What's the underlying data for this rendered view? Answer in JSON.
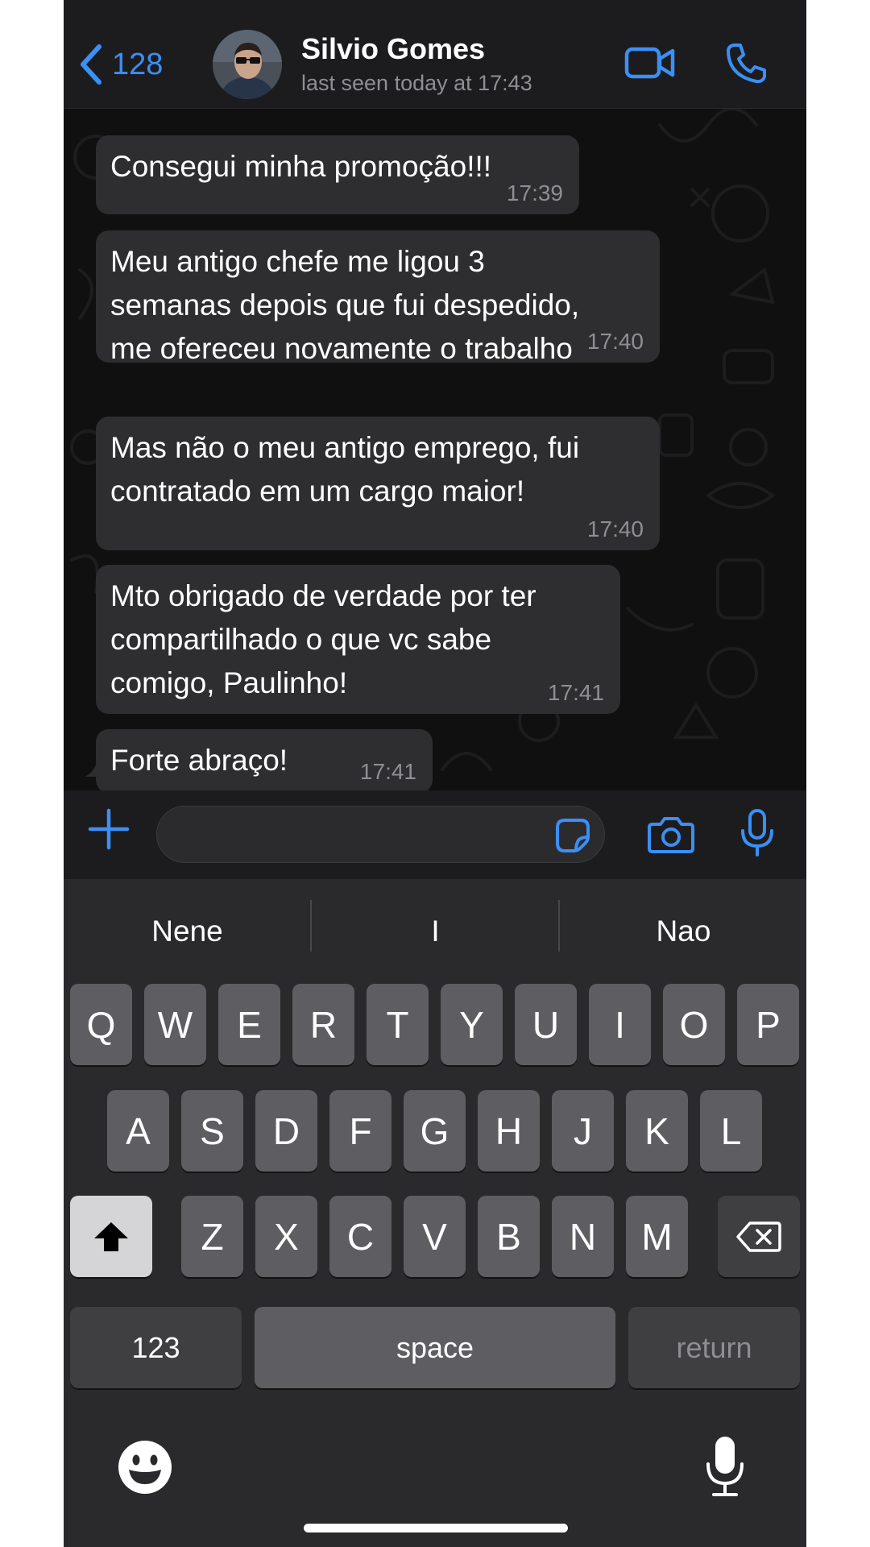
{
  "header": {
    "back_count": "128",
    "contact_name": "Silvio Gomes",
    "last_seen": "last seen today at 17:43"
  },
  "messages": [
    {
      "text": "Consegui minha promoção!!!",
      "time": "17:39"
    },
    {
      "text": "Meu antigo chefe me ligou 3\nsemanas depois que fui despedido,\nme ofereceu novamente o trabalho",
      "time": "17:40"
    },
    {
      "text": "Mas não o meu antigo emprego, fui\ncontratado em um cargo maior!",
      "time": "17:40"
    },
    {
      "text": "Mto obrigado de verdade por ter\ncompartilhado o que vc sabe\ncomigo, Paulinho!",
      "time": "17:41"
    },
    {
      "text": "Forte abraço!",
      "time": "17:41"
    }
  ],
  "composer": {
    "value": ""
  },
  "keyboard": {
    "suggestions": [
      "Nene",
      "I",
      "Nao"
    ],
    "rows": [
      [
        "Q",
        "W",
        "E",
        "R",
        "T",
        "Y",
        "U",
        "I",
        "O",
        "P"
      ],
      [
        "A",
        "S",
        "D",
        "F",
        "G",
        "H",
        "J",
        "K",
        "L"
      ],
      [
        "Z",
        "X",
        "C",
        "V",
        "B",
        "N",
        "M"
      ]
    ],
    "numbers_label": "123",
    "space_label": "space",
    "return_label": "return"
  },
  "colors": {
    "accent": "#3b8ff5",
    "bubble": "#2e2e30",
    "background": "#1c1c1e",
    "keyboard": "#2a2a2c",
    "key": "#5e5e62"
  },
  "icons": [
    "chevron-left-icon",
    "video-camera-icon",
    "phone-icon",
    "plus-icon",
    "sticker-icon",
    "camera-icon",
    "microphone-icon",
    "shift-icon",
    "delete-icon",
    "emoji-icon",
    "dictation-icon"
  ]
}
